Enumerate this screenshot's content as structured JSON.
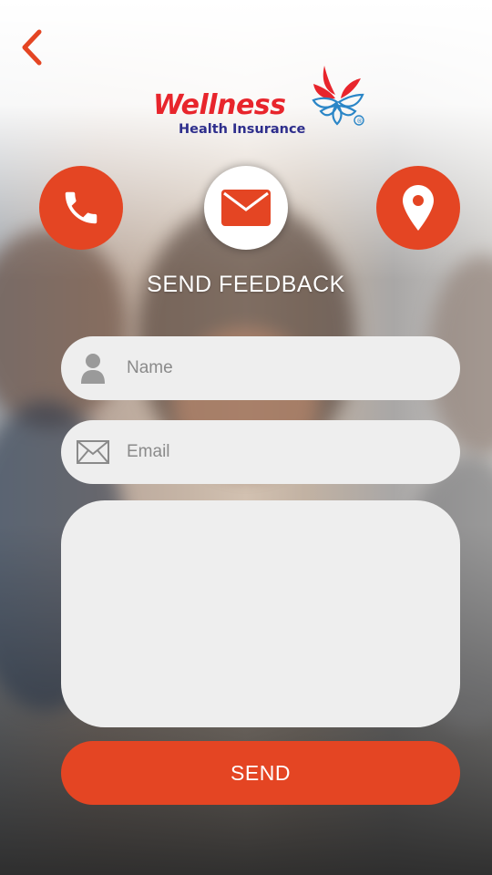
{
  "brand": {
    "name": "Wellness",
    "tagline": "Health Insurance",
    "registered_mark": "®",
    "colors": {
      "red": "#e8252c",
      "navy": "#2e2e8c",
      "accent": "#e44523"
    }
  },
  "nav": {
    "back_icon": "chevron-left-icon"
  },
  "contact_actions": [
    {
      "icon": "phone-icon",
      "selected": false
    },
    {
      "icon": "mail-icon",
      "selected": true
    },
    {
      "icon": "location-pin-icon",
      "selected": false
    }
  ],
  "page": {
    "title": "SEND FEEDBACK"
  },
  "form": {
    "name": {
      "placeholder": "Name",
      "value": "",
      "icon": "user-icon"
    },
    "email": {
      "placeholder": "Email",
      "value": "",
      "icon": "envelope-icon"
    },
    "message": {
      "placeholder": "",
      "value": ""
    },
    "submit_label": "SEND"
  }
}
